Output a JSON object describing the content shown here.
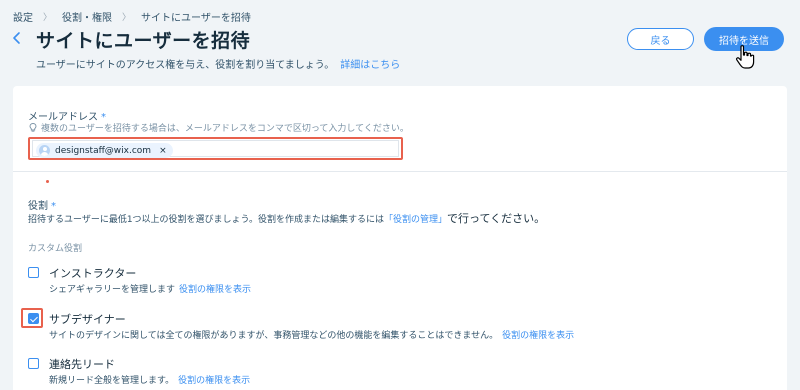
{
  "breadcrumb": [
    "設定",
    "役割・権限",
    "サイトにユーザーを招待"
  ],
  "header": {
    "title": "サイトにユーザーを招待",
    "subtitle": "ユーザーにサイトのアクセス権を与え、役割を割り当てましょう。",
    "learn_more": "詳細はこちら",
    "back_button": "戻る",
    "invite_button": "招待を送信"
  },
  "email": {
    "label": "メールアドレス",
    "required_mark": "*",
    "hint": "複数のユーザーを招待する場合は、メールアドレスをコンマで区切って入力してください。",
    "chips": [
      "designstaff@wix.com"
    ],
    "chip_remove": "×"
  },
  "roles": {
    "label": "役割",
    "required_mark": "*",
    "hint_before": "招待するユーザーに最低1つ以上の役割を選びましょう。役割を作成または編集するには",
    "hint_link": "「役割の管理」",
    "hint_after": "で行ってください。",
    "section": "カスタム役割",
    "items": [
      {
        "title": "インストラクター",
        "desc": "シェアギャラリーを管理します",
        "link": "役割の権限を表示",
        "checked": false
      },
      {
        "title": "サブデザイナー",
        "desc": "サイトのデザインに関しては全ての権限がありますが、事務管理などの他の機能を編集することはできません。",
        "link": "役割の権限を表示",
        "checked": true
      },
      {
        "title": "連絡先リード",
        "desc": "新規リード全般を管理します。",
        "link": "役割の権限を表示",
        "checked": false
      }
    ]
  },
  "colors": {
    "accent": "#3b8ff0",
    "highlight": "#e8614d",
    "background": "#f0f4f7"
  }
}
